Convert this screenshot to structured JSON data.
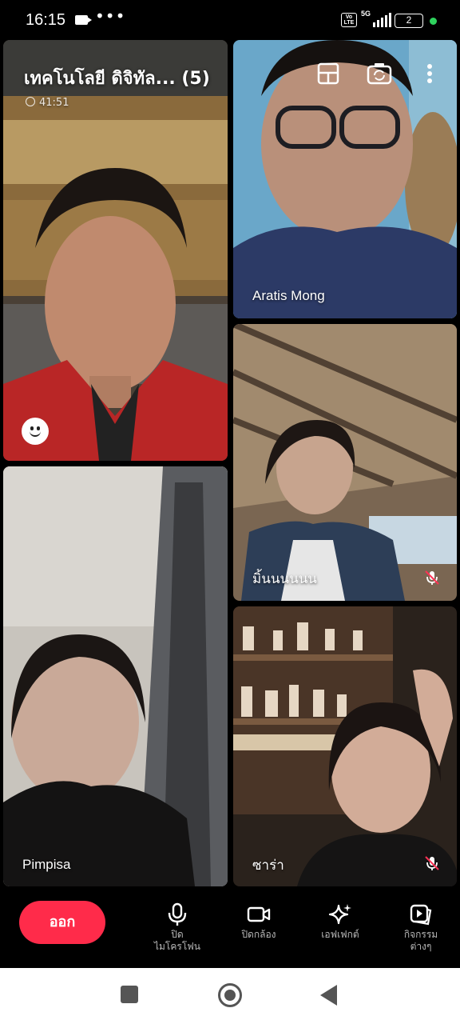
{
  "status_bar": {
    "time": "16:15",
    "more": "•••",
    "volte": "Vo LTE",
    "network": "5G",
    "battery": "2"
  },
  "call": {
    "title": "เทคโนโลยี ดิจิทัล... (5)",
    "timer": "41:51"
  },
  "participants": [
    {
      "name": "",
      "mic_muted": false
    },
    {
      "name": "Aratis Mong",
      "mic_muted": false
    },
    {
      "name": "มิ้นนนนนน",
      "mic_muted": true
    },
    {
      "name": "Pimpisa",
      "mic_muted": false
    },
    {
      "name": "ซาร่า",
      "mic_muted": true
    }
  ],
  "top_controls": [
    "layout-icon",
    "switch-camera-icon",
    "more-vertical-icon"
  ],
  "controls": {
    "leave": "ออก",
    "mic_line1": "ปิด",
    "mic_line2": "ไมโครโฟน",
    "camera": "ปิดกล้อง",
    "effects": "เอฟเฟกต์",
    "activities_line1": "กิจกรรม",
    "activities_line2": "ต่างๆ"
  },
  "colors": {
    "leave_button": "#ff2b4a",
    "background": "#000000",
    "status_dot": "#2fd35e"
  }
}
